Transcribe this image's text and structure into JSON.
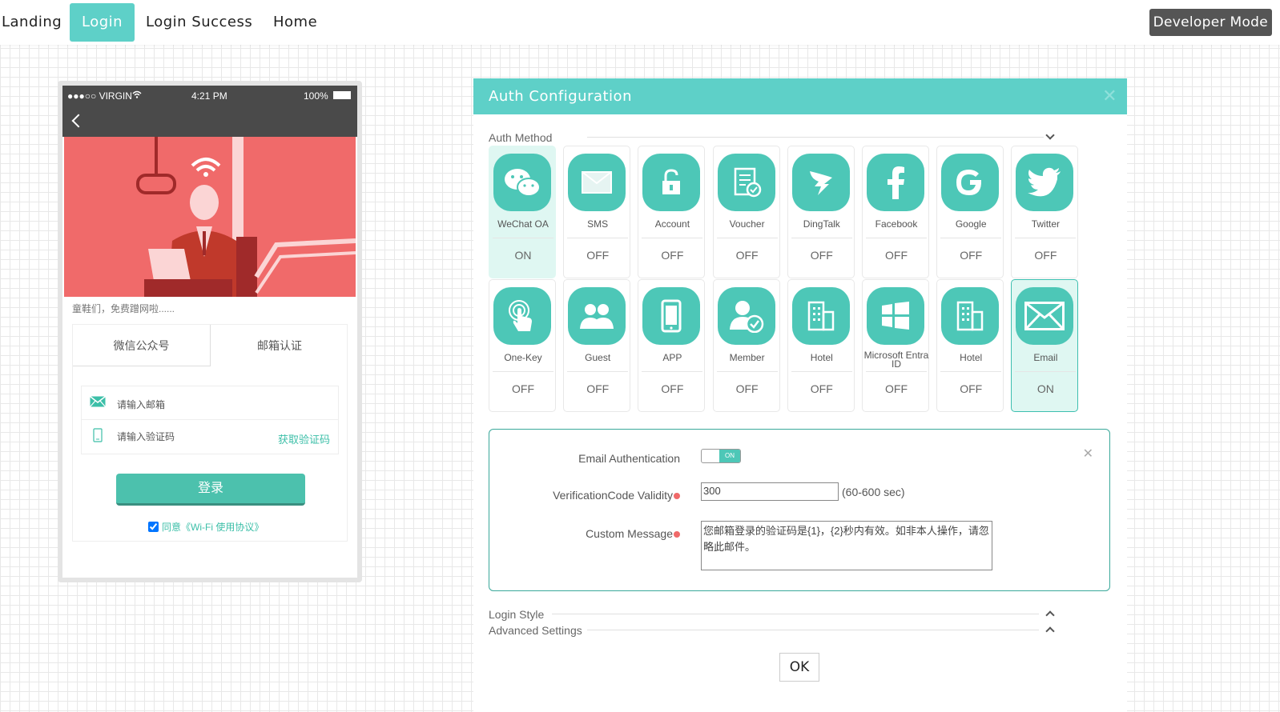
{
  "nav": {
    "tabs": [
      {
        "label": "Landing"
      },
      {
        "label": "Login"
      },
      {
        "label": "Login Success"
      },
      {
        "label": "Home"
      }
    ],
    "developer_mode": "Developer Mode"
  },
  "phone": {
    "carrier": "●●●○○ VIRGIN",
    "time": "4:21 PM",
    "battery": "100%",
    "caption": "童鞋们，免费蹭网啦......",
    "tabs": [
      "微信公众号",
      "邮箱认证"
    ],
    "email_placeholder": "请输入邮箱",
    "code_placeholder": "请输入验证码",
    "get_code": "获取验证码",
    "login_button": "登录",
    "agreement": "同意《Wi-Fi 使用协议》",
    "agreement_checked": true
  },
  "auth": {
    "title": "Auth Configuration",
    "section_auth_method": "Auth Method",
    "methods": [
      {
        "name": "WeChat OA",
        "state": "ON",
        "icon": "wechat-icon"
      },
      {
        "name": "SMS",
        "state": "OFF",
        "icon": "sms-icon"
      },
      {
        "name": "Account",
        "state": "OFF",
        "icon": "lock-icon"
      },
      {
        "name": "Voucher",
        "state": "OFF",
        "icon": "voucher-icon"
      },
      {
        "name": "DingTalk",
        "state": "OFF",
        "icon": "dingtalk-icon"
      },
      {
        "name": "Facebook",
        "state": "OFF",
        "icon": "facebook-icon"
      },
      {
        "name": "Google",
        "state": "OFF",
        "icon": "google-icon"
      },
      {
        "name": "Twitter",
        "state": "OFF",
        "icon": "twitter-icon"
      },
      {
        "name": "One-Key",
        "state": "OFF",
        "icon": "one-key-icon"
      },
      {
        "name": "Guest",
        "state": "OFF",
        "icon": "guest-icon"
      },
      {
        "name": "APP",
        "state": "OFF",
        "icon": "phone-icon"
      },
      {
        "name": "Member",
        "state": "OFF",
        "icon": "member-icon"
      },
      {
        "name": "Hotel",
        "state": "OFF",
        "icon": "hotel-icon"
      },
      {
        "name": "Microsoft Entra ID",
        "state": "OFF",
        "icon": "windows-icon"
      },
      {
        "name": "Hotel",
        "state": "OFF",
        "icon": "hotel-icon"
      },
      {
        "name": "Email",
        "state": "ON",
        "icon": "email-icon"
      }
    ],
    "email_config": {
      "auth_label": "Email Authentication",
      "toggle_state": "ON",
      "validity_label": "VerificationCode Validity",
      "validity_value": "300",
      "validity_unit": "(60-600 sec)",
      "message_label": "Custom Message",
      "message_value": "您邮箱登录的验证码是{1}，{2}秒内有效。如非本人操作，请忽略此邮件。"
    },
    "section_login_style": "Login Style",
    "section_advanced": "Advanced Settings",
    "ok_button": "OK"
  },
  "colors": {
    "accent": "#5ed0c8",
    "icon_bg": "#4dc7b7",
    "banner": "#f06a6a"
  }
}
